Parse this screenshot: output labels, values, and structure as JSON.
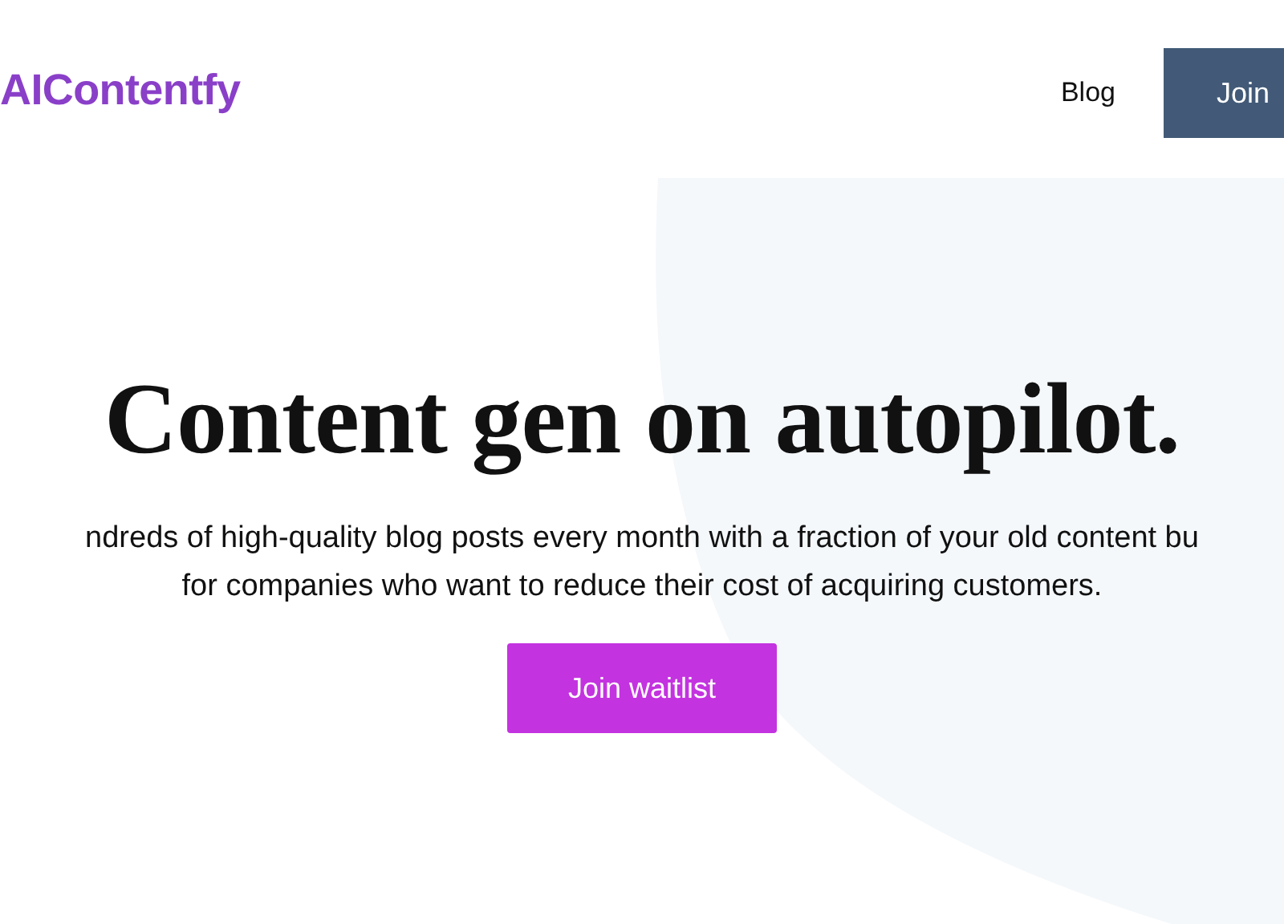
{
  "header": {
    "logo": "AIContentfy",
    "nav": [
      {
        "label": "Blog"
      }
    ],
    "cta": "Join"
  },
  "hero": {
    "title": "Content gen on autopilot.",
    "lines": [
      "ndreds of high-quality blog posts every month with a fraction of your old content bu",
      "for companies who want to reduce their cost of acquiring customers."
    ],
    "button": "Join waitlist"
  }
}
